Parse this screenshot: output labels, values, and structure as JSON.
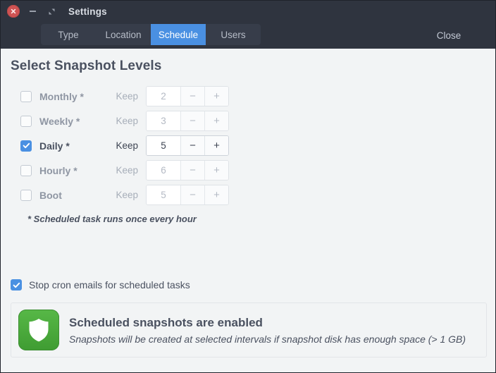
{
  "window": {
    "title": "Settings",
    "controls": {
      "close": "close-icon",
      "minimize": "minimize-icon",
      "maximize": "maximize-icon"
    },
    "accent": "#4a90e2",
    "header_bg": "#2f343f",
    "content_bg": "#f2f4f5"
  },
  "header": {
    "tabs": [
      {
        "label": "Type",
        "active": false
      },
      {
        "label": "Location",
        "active": false
      },
      {
        "label": "Schedule",
        "active": true
      },
      {
        "label": "Users",
        "active": false
      }
    ],
    "close_label": "Close"
  },
  "main": {
    "section_title": "Select Snapshot Levels",
    "keep_label": "Keep",
    "minus_label": "−",
    "plus_label": "+",
    "levels": [
      {
        "name": "Monthly *",
        "checked": false,
        "keep": "2"
      },
      {
        "name": "Weekly *",
        "checked": false,
        "keep": "3"
      },
      {
        "name": "Daily *",
        "checked": true,
        "keep": "5"
      },
      {
        "name": "Hourly *",
        "checked": false,
        "keep": "6"
      },
      {
        "name": "Boot",
        "checked": false,
        "keep": "5"
      }
    ],
    "note": "* Scheduled task runs once every hour",
    "cron": {
      "label": "Stop cron emails for scheduled tasks",
      "checked": true
    },
    "info": {
      "icon": "shield-icon",
      "icon_color": "#4aa83c",
      "title": "Scheduled snapshots are enabled",
      "subtitle": "Snapshots will be created at selected intervals if snapshot disk has enough space (> 1 GB)"
    }
  }
}
